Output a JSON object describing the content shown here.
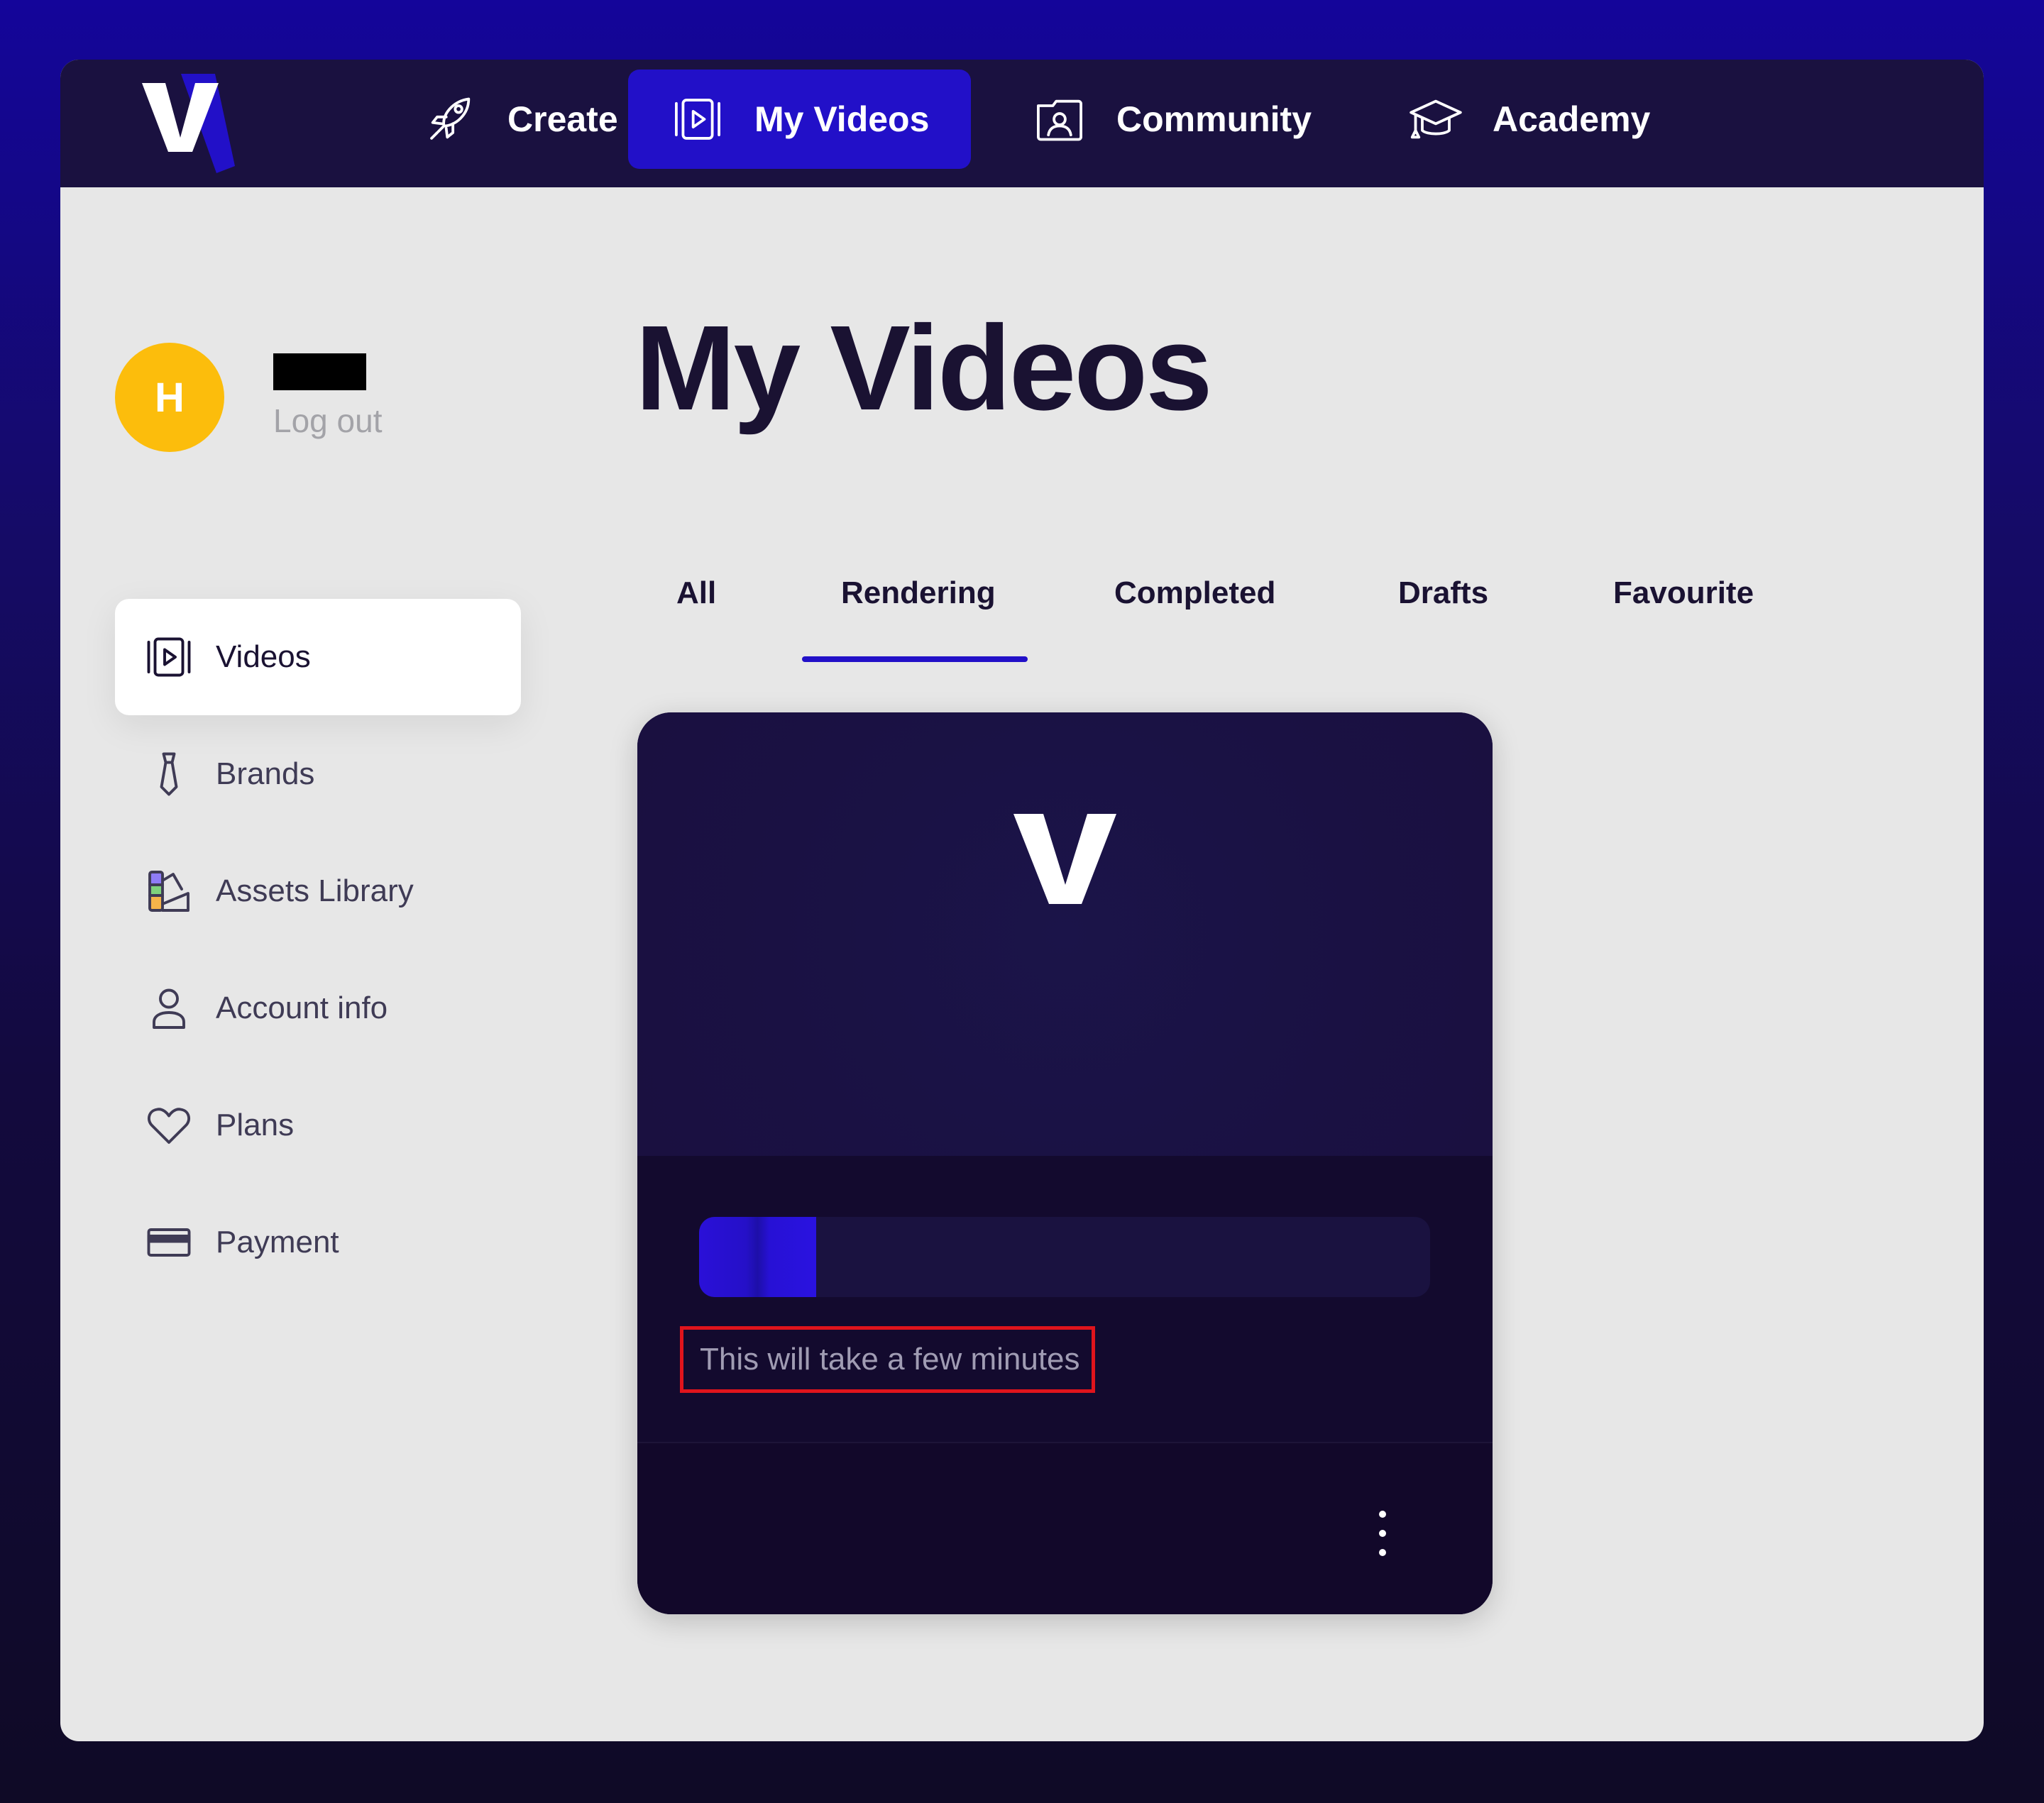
{
  "nav": {
    "items": [
      {
        "label": "Create",
        "icon": "rocket-icon"
      },
      {
        "label": "My Videos",
        "icon": "video-icon",
        "active": true
      },
      {
        "label": "Community",
        "icon": "community-icon"
      },
      {
        "label": "Academy",
        "icon": "graduation-cap-icon"
      }
    ]
  },
  "profile": {
    "avatar_initial": "H",
    "logout_label": "Log out"
  },
  "sidebar": {
    "items": [
      {
        "label": "Videos",
        "icon": "video-icon",
        "active": true
      },
      {
        "label": "Brands",
        "icon": "tie-icon"
      },
      {
        "label": "Assets Library",
        "icon": "assets-icon"
      },
      {
        "label": "Account info",
        "icon": "user-icon"
      },
      {
        "label": "Plans",
        "icon": "heart-icon"
      },
      {
        "label": "Payment",
        "icon": "card-icon"
      }
    ]
  },
  "main": {
    "title": "My Videos",
    "tabs": [
      {
        "label": "All"
      },
      {
        "label": "Rendering",
        "active": true
      },
      {
        "label": "Completed"
      },
      {
        "label": "Drafts"
      },
      {
        "label": "Favourite"
      }
    ]
  },
  "video_card": {
    "render_progress": 0.16,
    "status_text": "This will take a few minutes"
  },
  "colors": {
    "nav_bg": "#1a1140",
    "accent": "#2210c8",
    "avatar": "#fcbd0c",
    "highlight_border": "#e0141c"
  }
}
